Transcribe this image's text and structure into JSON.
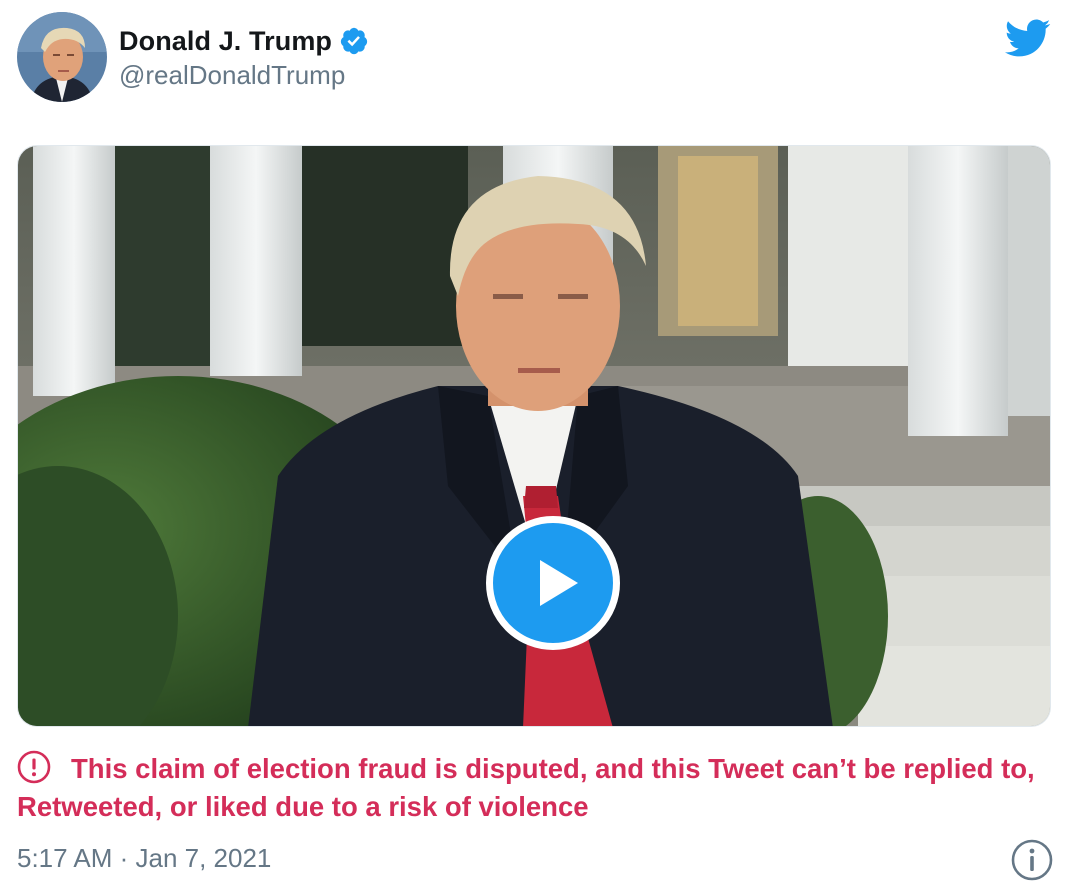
{
  "author": {
    "display_name": "Donald J. Trump",
    "handle": "@realDonaldTrump",
    "verified": true
  },
  "icons": {
    "verified": "verified-badge-icon",
    "brand": "twitter-bird-icon",
    "warning": "exclamation-circle-icon",
    "info": "info-circle-icon",
    "play": "play-icon"
  },
  "media": {
    "type": "video"
  },
  "warning_label": "This claim of election fraud is disputed, and this Tweet can’t be replied to, Retweeted, or liked due to a risk of violence",
  "timestamp": "5:17 AM · Jan 7, 2021",
  "colors": {
    "brand_blue": "#1d9bf0",
    "warning_red": "#d42d59",
    "secondary_text": "#657786",
    "primary_text": "#14171a"
  }
}
